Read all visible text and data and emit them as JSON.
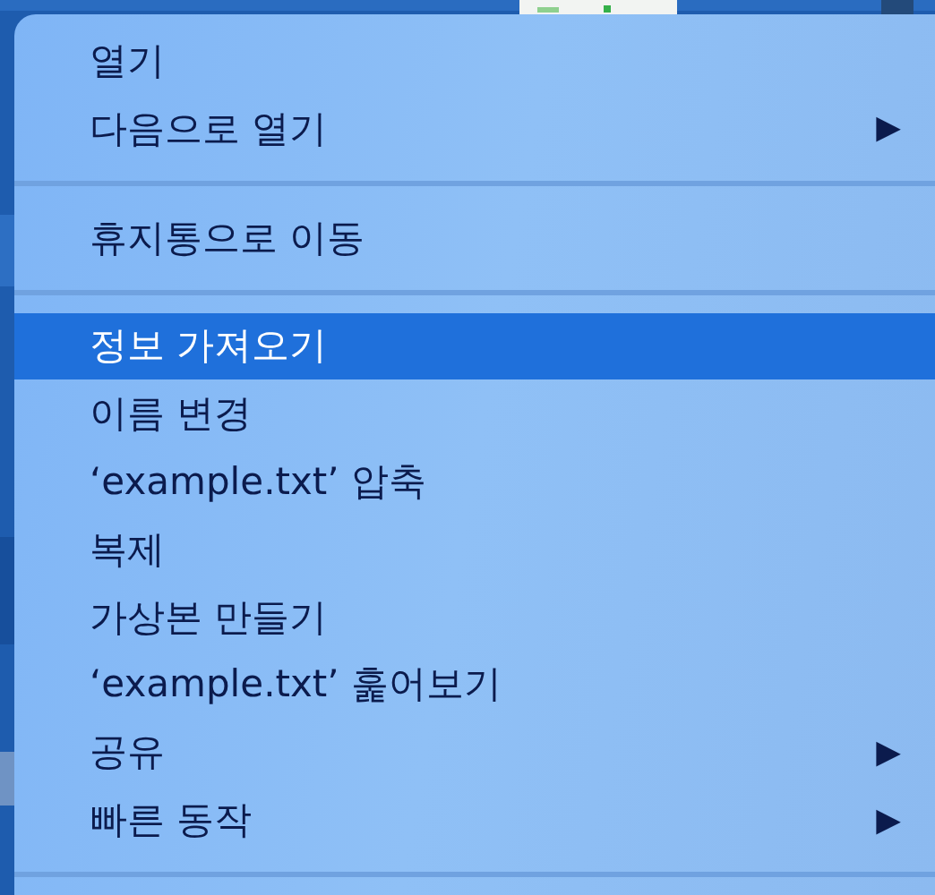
{
  "menu": {
    "items": [
      {
        "kind": "item",
        "label": "열기",
        "selected": false
      },
      {
        "kind": "item",
        "label": "다음으로 열기",
        "selected": false,
        "arrow": "▶"
      },
      {
        "kind": "separator"
      },
      {
        "kind": "item",
        "label": "휴지통으로 이동",
        "selected": false
      },
      {
        "kind": "separator"
      },
      {
        "kind": "item",
        "label": "정보 가져오기",
        "selected": true
      },
      {
        "kind": "item",
        "label": "이름 변경",
        "selected": false
      },
      {
        "kind": "item",
        "label": "‘example.txt’ 압축",
        "selected": false
      },
      {
        "kind": "item",
        "label": "복제",
        "selected": false
      },
      {
        "kind": "item",
        "label": "가상본 만들기",
        "selected": false
      },
      {
        "kind": "item",
        "label": "‘example.txt’ 훑어보기",
        "selected": false
      },
      {
        "kind": "item",
        "label": "공유",
        "selected": false,
        "arrow": "▶"
      },
      {
        "kind": "item",
        "label": "빠른 동작",
        "selected": false,
        "arrow": "▶"
      },
      {
        "kind": "separator"
      }
    ]
  }
}
